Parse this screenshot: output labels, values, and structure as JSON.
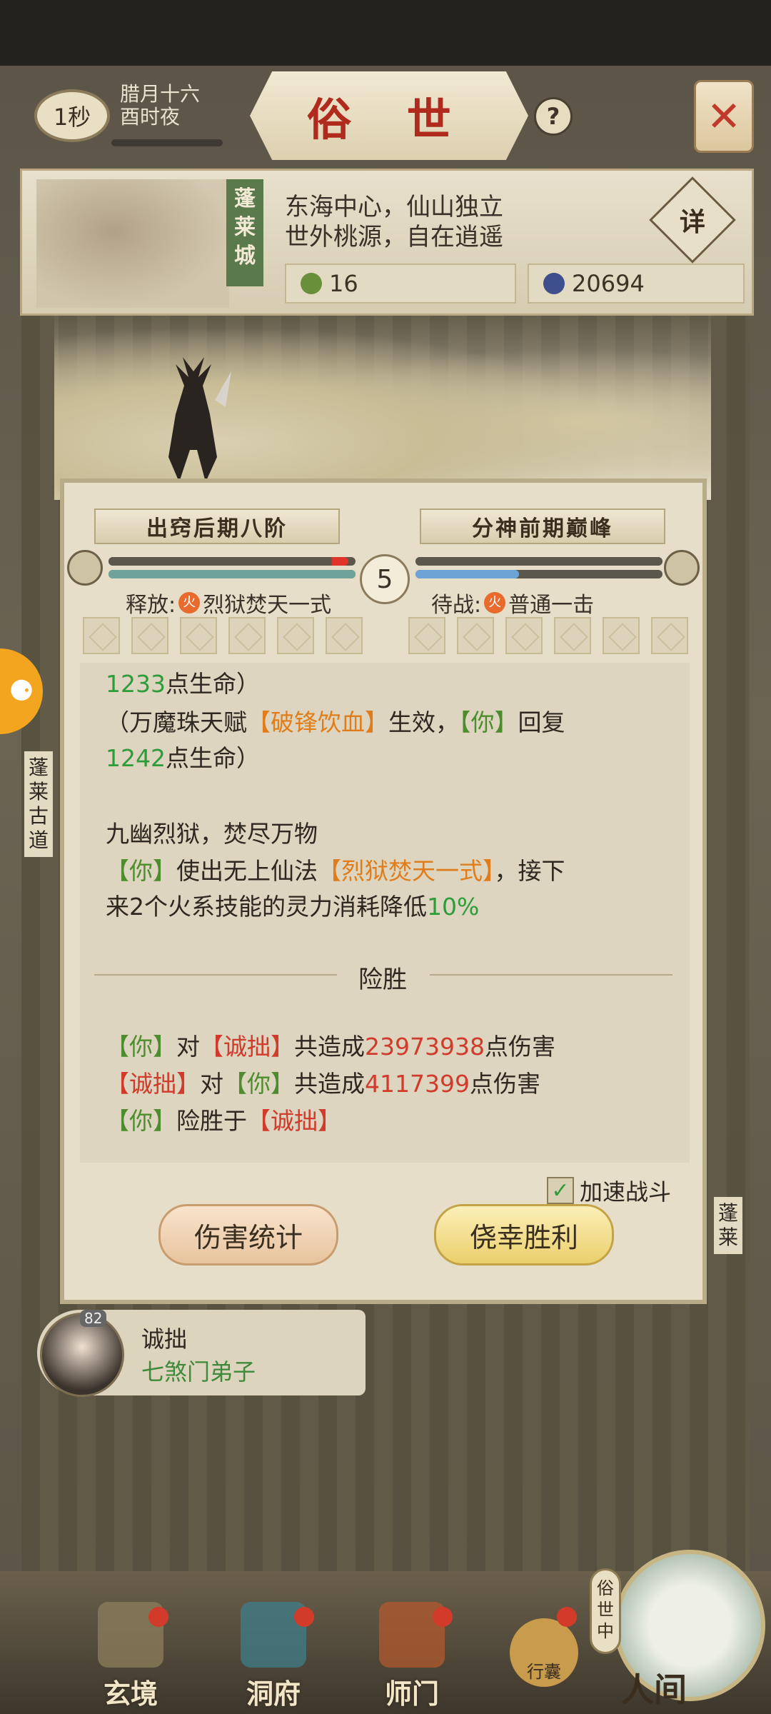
{
  "header": {
    "time_badge": "1秒",
    "date_line1": "腊月十六",
    "date_line2": "酉时夜",
    "title": "俗 世",
    "help_glyph": "?",
    "close_glyph": "✕"
  },
  "location": {
    "name": "蓬莱城",
    "desc_line1": "东海中心，仙山独立",
    "desc_line2": "世外桃源，自在逍遥",
    "detail_label": "详",
    "resource1_value": "16",
    "resource2_value": "20694"
  },
  "side": {
    "left_road": "蓬莱古道",
    "right_road": "蓬莱"
  },
  "battle": {
    "left_rank": "出窍后期八阶",
    "right_rank": "分神前期巅峰",
    "round": "5",
    "left_skill_prefix": "释放:",
    "left_skill_elem": "火",
    "left_skill": "烈狱焚天一式",
    "right_skill_prefix": "待战:",
    "right_skill_elem": "火",
    "right_skill": "普通一击",
    "left_hp_pct": 97,
    "left_mp_pct": 100,
    "right_hp_pct": 100,
    "right_mp_pct": 42,
    "log": {
      "l1_num": "1233",
      "l1_txt": "点生命）",
      "l2_a": "（万魔珠天赋",
      "l2_b": "【破锋饮血】",
      "l2_c": "生效，",
      "l2_d": "【你】",
      "l2_e": "回复",
      "l3_num": "1242",
      "l3_txt": "点生命）",
      "l4": "九幽烈狱，焚尽万物",
      "l5_a": "【你】",
      "l5_b": "使出无上仙法",
      "l5_c": "【烈狱焚天一式】",
      "l5_d": "，接下",
      "l6_a": "来2个火系技能的灵力消耗降低",
      "l6_b": "10%"
    },
    "verdict": "险胜",
    "summary": {
      "s1_a": "【你】",
      "s1_b": "对",
      "s1_c": "【诚拙】",
      "s1_d": "共造成",
      "s1_e": "23973938",
      "s1_f": "点伤害",
      "s2_a": "【诚拙】",
      "s2_b": "对",
      "s2_c": "【你】",
      "s2_d": "共造成",
      "s2_e": "4117399",
      "s2_f": "点伤害",
      "s3_a": "【你】",
      "s3_b": "险胜于",
      "s3_c": "【诚拙】"
    },
    "speed_label": "加速战斗",
    "speed_checked": true,
    "btn_stats": "伤害统计",
    "btn_result": "侥幸胜利"
  },
  "opponent": {
    "level": "82",
    "name": "诚拙",
    "sect": "七煞门弟子"
  },
  "nav": {
    "items": [
      "玄境",
      "洞府",
      "师门"
    ],
    "bag": "行囊",
    "world_tag": "俗世中",
    "world": "人间"
  },
  "colors": {
    "green": "#2e9c3a",
    "orange": "#e07d1a",
    "red": "#d03b2c",
    "title_red": "#b02a1e"
  }
}
